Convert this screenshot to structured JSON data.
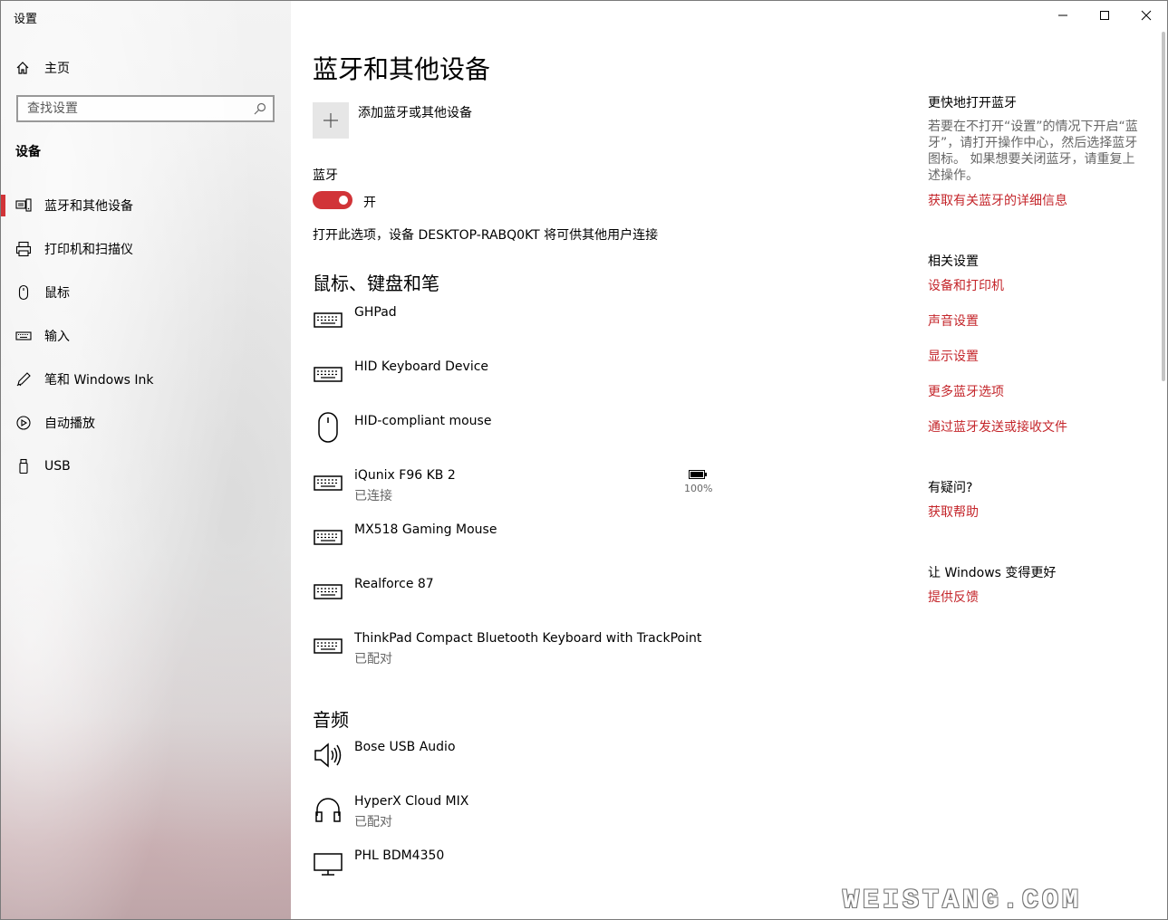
{
  "app": {
    "title": "设置"
  },
  "sidebar": {
    "home_label": "主页",
    "search_placeholder": "查找设置",
    "section": "设备",
    "items": [
      {
        "label": "蓝牙和其他设备",
        "icon": "bluetooth-devices-icon",
        "active": true
      },
      {
        "label": "打印机和扫描仪",
        "icon": "printer-icon"
      },
      {
        "label": "鼠标",
        "icon": "mouse-icon"
      },
      {
        "label": "输入",
        "icon": "keyboard-icon"
      },
      {
        "label": "笔和 Windows Ink",
        "icon": "pen-icon"
      },
      {
        "label": "自动播放",
        "icon": "autoplay-icon"
      },
      {
        "label": "USB",
        "icon": "usb-icon"
      }
    ]
  },
  "main": {
    "title": "蓝牙和其他设备",
    "add_device_label": "添加蓝牙或其他设备",
    "bluetooth_label": "蓝牙",
    "bluetooth_state": "开",
    "bluetooth_description": "打开此选项，设备 DESKTOP-RABQ0KT 将可供其他用户连接",
    "groups": [
      {
        "title": "鼠标、键盘和笔",
        "devices": [
          {
            "name": "GHPad",
            "status": "",
            "icon": "keyboard-icon"
          },
          {
            "name": "HID Keyboard Device",
            "status": "",
            "icon": "keyboard-icon"
          },
          {
            "name": "HID-compliant mouse",
            "status": "",
            "icon": "mouse-icon"
          },
          {
            "name": "iQunix F96 KB 2",
            "status": "已连接",
            "icon": "keyboard-icon",
            "battery": "100%"
          },
          {
            "name": "MX518 Gaming Mouse",
            "status": "",
            "icon": "keyboard-icon"
          },
          {
            "name": "Realforce 87",
            "status": "",
            "icon": "keyboard-icon"
          },
          {
            "name": "ThinkPad Compact Bluetooth Keyboard with TrackPoint",
            "status": "已配对",
            "icon": "keyboard-icon"
          }
        ]
      },
      {
        "title": "音频",
        "devices": [
          {
            "name": "Bose USB Audio",
            "status": "",
            "icon": "speaker-icon"
          },
          {
            "name": "HyperX Cloud MIX",
            "status": "已配对",
            "icon": "headphones-icon"
          },
          {
            "name": "PHL BDM4350",
            "status": "",
            "icon": "monitor-icon"
          }
        ]
      }
    ]
  },
  "right": {
    "quick_title": "更快地打开蓝牙",
    "quick_text": "若要在不打开“设置”的情况下开启“蓝牙”，请打开操作中心，然后选择蓝牙图标。 如果想要关闭蓝牙，请重复上述操作。",
    "quick_link": "获取有关蓝牙的详细信息",
    "related_title": "相关设置",
    "related_links": [
      "设备和打印机",
      "声音设置",
      "显示设置",
      "更多蓝牙选项",
      "通过蓝牙发送或接收文件"
    ],
    "help_title": "有疑问?",
    "help_link": "获取帮助",
    "feedback_title": "让 Windows 变得更好",
    "feedback_link": "提供反馈"
  },
  "watermark": "WEISTANG.COM",
  "colors": {
    "accent": "#d13438",
    "link": "#c4262b"
  }
}
